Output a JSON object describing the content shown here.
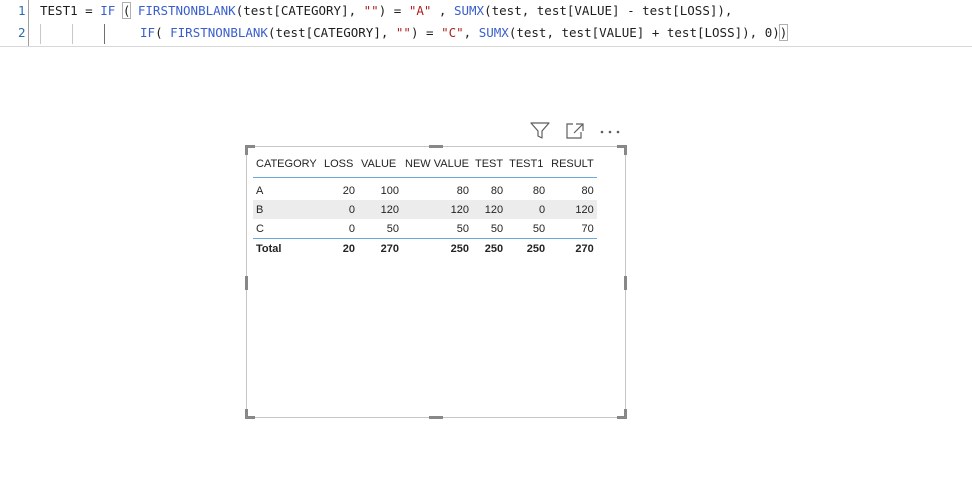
{
  "editor": {
    "line_numbers": [
      "1",
      "2"
    ],
    "line1": [
      {
        "t": "TEST1 = ",
        "c": ""
      },
      {
        "t": "IF",
        "c": "kw"
      },
      {
        "t": " ",
        "c": ""
      },
      {
        "t": "(",
        "c": "hl"
      },
      {
        "t": " ",
        "c": ""
      },
      {
        "t": "FIRSTNONBLANK",
        "c": "kw"
      },
      {
        "t": "(test[CATEGORY], ",
        "c": ""
      },
      {
        "t": "\"\"",
        "c": "str"
      },
      {
        "t": ") = ",
        "c": ""
      },
      {
        "t": "\"A\"",
        "c": "str"
      },
      {
        "t": " , ",
        "c": ""
      },
      {
        "t": "SUMX",
        "c": "kw"
      },
      {
        "t": "(test, test[VALUE] - test[LOSS]),",
        "c": ""
      }
    ],
    "line2": [
      {
        "t": "IF",
        "c": "kw"
      },
      {
        "t": "( ",
        "c": ""
      },
      {
        "t": "FIRSTNONBLANK",
        "c": "kw"
      },
      {
        "t": "(test[CATEGORY], ",
        "c": ""
      },
      {
        "t": "\"\"",
        "c": "str"
      },
      {
        "t": ") = ",
        "c": ""
      },
      {
        "t": "\"C\"",
        "c": "str"
      },
      {
        "t": ", ",
        "c": ""
      },
      {
        "t": "SUMX",
        "c": "kw"
      },
      {
        "t": "(test, test[VALUE] + test[LOSS]), 0)",
        "c": ""
      },
      {
        "t": ")",
        "c": "hl"
      }
    ]
  },
  "visual_header": {
    "icons": [
      "filter-icon",
      "focus-mode-icon",
      "more-options-icon"
    ]
  },
  "table": {
    "columns": [
      "CATEGORY",
      "LOSS",
      "VALUE",
      "NEW VALUE",
      "TEST",
      "TEST1",
      "RESULT"
    ],
    "rows": [
      [
        "A",
        "20",
        "100",
        "80",
        "80",
        "80",
        "80"
      ],
      [
        "B",
        "0",
        "120",
        "120",
        "120",
        "0",
        "120"
      ],
      [
        "C",
        "0",
        "50",
        "50",
        "50",
        "50",
        "70"
      ]
    ],
    "total": [
      "Total",
      "20",
      "270",
      "250",
      "250",
      "250",
      "270"
    ]
  },
  "colors": {
    "keyword": "#3a5fcd",
    "string": "#b01f1f",
    "line_number": "#2b6cb0",
    "table_rule": "#6fa8dc",
    "stripe": "#ececec"
  }
}
